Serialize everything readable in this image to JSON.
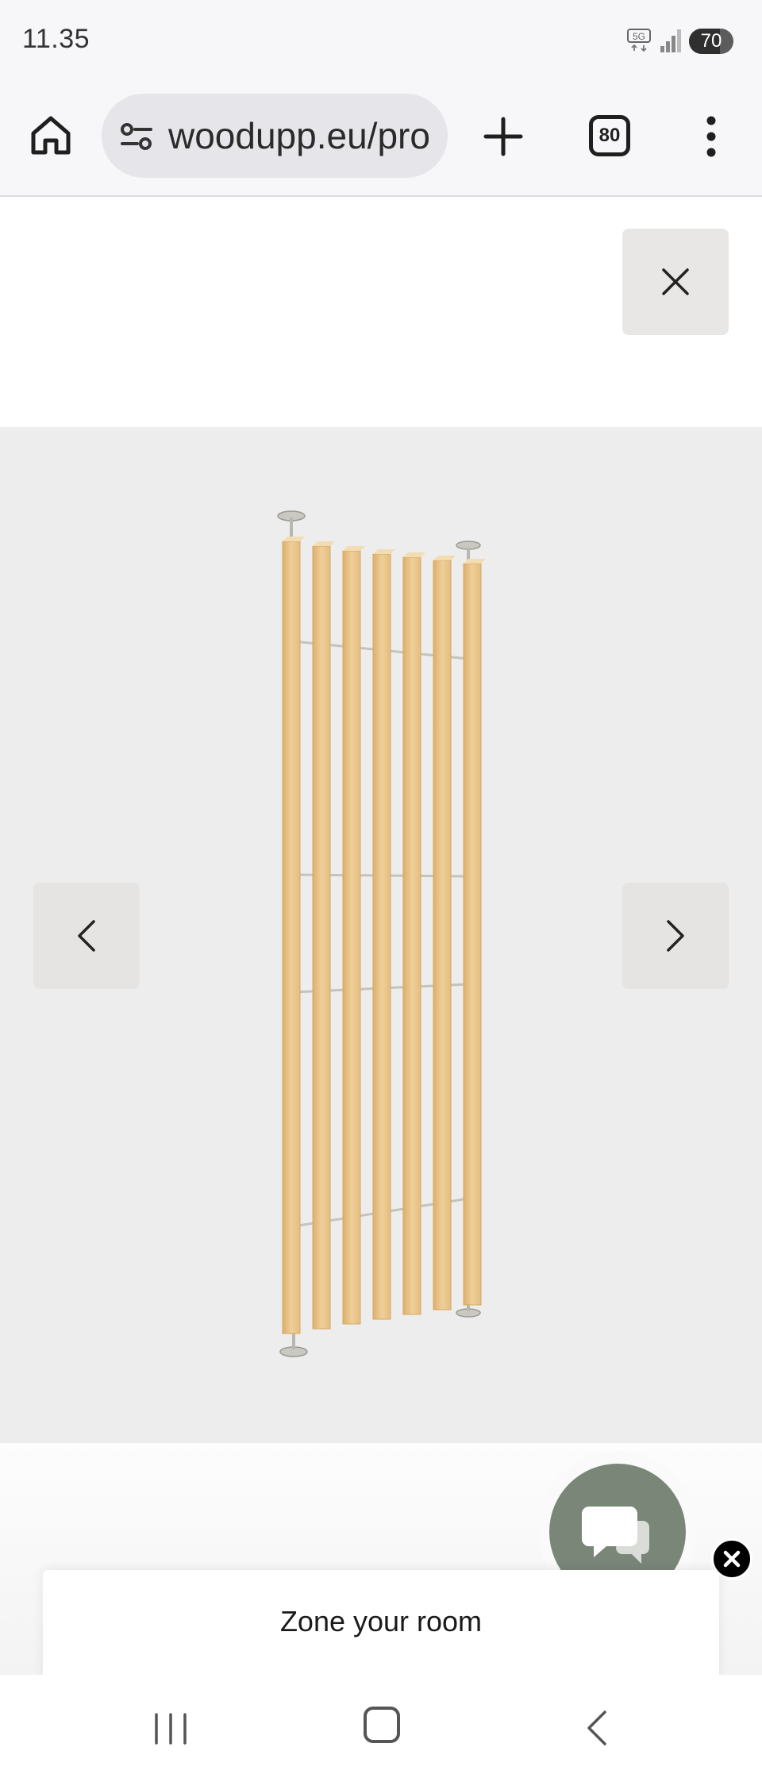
{
  "status": {
    "time": "11.35",
    "network": "5G",
    "battery_level": 70,
    "battery_label": "70"
  },
  "browser": {
    "url": "woodupp.eu/pro",
    "tab_count": "80",
    "icons": {
      "home": "home-icon",
      "site_settings": "tune-icon",
      "new_tab": "plus-icon",
      "tabs": "tab-switcher-icon",
      "menu": "more-vert-icon"
    }
  },
  "page": {
    "close_icon": "close-icon",
    "gallery": {
      "prev_icon": "chevron-left-icon",
      "next_icon": "chevron-right-icon",
      "image": "wooden slat room divider"
    },
    "chat": {
      "icon": "chat-bubbles-icon",
      "dismiss_icon": "close-circle-icon"
    },
    "card": {
      "title": "Zone your room"
    }
  },
  "system_nav": {
    "icons": [
      "recent-apps-icon",
      "home-circle-icon",
      "back-icon"
    ]
  },
  "colors": {
    "wood": "#e9c48a",
    "wood_dark": "#d6a863",
    "chat": "#798678",
    "gallery_bg": "#ededed"
  }
}
